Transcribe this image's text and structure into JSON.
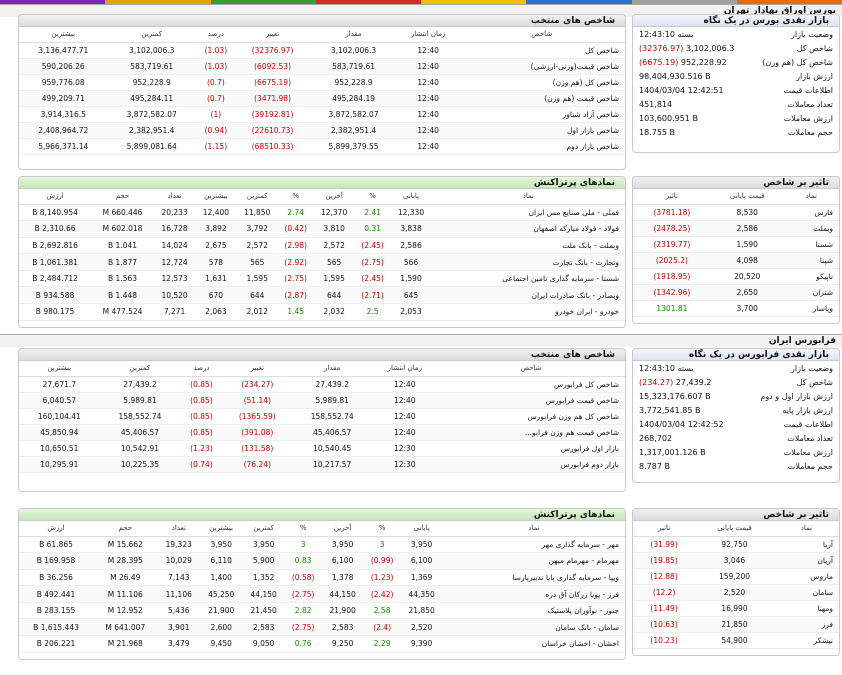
{
  "colors": {
    "negative": "#c00000",
    "positive": "#118a00",
    "topbar": [
      "#7b2ab8",
      "#e8a000",
      "#3a9c2f",
      "#d42a2a",
      "#f0c000",
      "#2a6fd4",
      "#a0a0a0",
      "#e86a00"
    ]
  },
  "tehran": {
    "title": "بورس اوراق بهادار تهران",
    "summary_title": "بازار نقدی بورس در یک نگاه",
    "summary": [
      {
        "k": "وضعیت بازار",
        "v": "بسته 12:43:10",
        "c": ""
      },
      {
        "k": "شاخص کل",
        "v": "3,102,006.3",
        "ch": "(32376.97)",
        "c": "neg"
      },
      {
        "k": "شاخص کل (هم وزن)",
        "v": "952,228.92",
        "ch": "(6675.19)",
        "c": "neg"
      },
      {
        "k": "ارزش بازار",
        "v": "98,404,930.516 B",
        "c": ""
      },
      {
        "k": "اطلاعات قیمت",
        "v": "1404/03/04 12:42:51",
        "c": ""
      },
      {
        "k": "تعداد معاملات",
        "v": "451,814",
        "c": ""
      },
      {
        "k": "ارزش معاملات",
        "v": "103,600.951 B",
        "c": ""
      },
      {
        "k": "حجم معاملات",
        "v": "18.755 B",
        "c": ""
      }
    ],
    "indices_title": "شاخص های منتخب",
    "indices_headers": [
      "شاخص",
      "زمان انتشار",
      "مقدار",
      "تغییر",
      "درصد",
      "کمترین",
      "بیشترین"
    ],
    "indices": [
      [
        "شاخص کل",
        "12:40",
        "3,102,006.3",
        "(32376.97)",
        "(1.03)",
        "3,102,006.3",
        "3,136,477.71"
      ],
      [
        "شاخص قیمت(وزنی-ارزشی)",
        "12:40",
        "583,719.61",
        "(6092.53)",
        "(1.03)",
        "583,719.61",
        "590,206.26"
      ],
      [
        "شاخص کل (هم وزن)",
        "12:40",
        "952,228.9",
        "(6675.19)",
        "(0.7)",
        "952,228.9",
        "959,776.08"
      ],
      [
        "شاخص قیمت (هم وزن)",
        "12:40",
        "495,284.19",
        "(3471.98)",
        "(0.7)",
        "495,284.11",
        "499,209.71"
      ],
      [
        "شاخص آزاد شناور",
        "12:40",
        "3,872,582.07",
        "(39192.81)",
        "(1)",
        "3,872,582.07",
        "3,914,316.5"
      ],
      [
        "شاخص بازار اول",
        "12:40",
        "2,382,951.4",
        "(22610.73)",
        "(0.94)",
        "2,382,951.4",
        "2,408,964.72"
      ],
      [
        "شاخص بازار دوم",
        "12:40",
        "5,899,379.55",
        "(68510.33)",
        "(1.15)",
        "5,899,081.64",
        "5,966,371.14"
      ]
    ],
    "impact_title": "تاثیر بر شاخص",
    "impact_headers": [
      "نماد",
      "قیمت پایانی",
      "تاثیر"
    ],
    "impact": [
      [
        "فارس",
        "8,530",
        "(3781.18)",
        "neg"
      ],
      [
        "وبملت",
        "2,586",
        "(2478.25)",
        "neg"
      ],
      [
        "شستا",
        "1,590",
        "(2319.77)",
        "neg"
      ],
      [
        "شپنا",
        "4,098",
        "(2025.2)",
        "neg"
      ],
      [
        "تاپیکو",
        "20,520",
        "(1918.95)",
        "neg"
      ],
      [
        "شتران",
        "2,650",
        "(1342.96)",
        "neg"
      ],
      [
        "وپاسار",
        "3,700",
        "1301.81",
        "pos"
      ]
    ],
    "top_title": "نمادهای پرتراکنش",
    "top_headers": [
      "نماد",
      "پایانی",
      "%",
      "آخرین",
      "%",
      "کمترین",
      "بیشترین",
      "تعداد",
      "حجم",
      "ارزش"
    ],
    "top": [
      [
        "فملی - ملی صنایع مس ایران",
        "12,330",
        "2.41",
        "12,370",
        "2.74",
        "11,850",
        "12,400",
        "20,233",
        "660.446 M",
        "8,140.954 B",
        "pos",
        "pos"
      ],
      [
        "فولاد - فولاد مبارکه اصفهان",
        "3,838",
        "0.31",
        "3,810",
        "(0.42)",
        "3,792",
        "3,892",
        "16,728",
        "602.018 M",
        "2,310.66 B",
        "pos",
        "neg"
      ],
      [
        "وبملت - بانک ملت",
        "2,586",
        "(2.45)",
        "2,572",
        "(2.98)",
        "2,572",
        "2,675",
        "14,024",
        "1.041 B",
        "2,692.816 B",
        "neg",
        "neg"
      ],
      [
        "وتجارت - بانک تجارت",
        "566",
        "(2.75)",
        "565",
        "(2.92)",
        "565",
        "578",
        "12,724",
        "1.877 B",
        "1,061.381 B",
        "neg",
        "neg"
      ],
      [
        "شستا - سرمایه گذاری تامین اجتماعی",
        "1,590",
        "(2.45)",
        "1,595",
        "(2.75)",
        "1,595",
        "1,631",
        "12,573",
        "1.563 B",
        "2,484.712 B",
        "neg",
        "neg"
      ],
      [
        "وبصادر - بانک صادرات ایران",
        "645",
        "(2.71)",
        "644",
        "(2.87)",
        "644",
        "670",
        "10,520",
        "1.448 B",
        "934.588 B",
        "neg",
        "neg"
      ],
      [
        "خودرو - ایران خودرو",
        "2,053",
        "2.5",
        "2,032",
        "1.45",
        "2,012",
        "2,063",
        "7,271",
        "477.524 M",
        "980.175 B",
        "pos",
        "pos"
      ]
    ]
  },
  "farabourse": {
    "title": "فرابورس ایران",
    "summary_title": "بازار نقدی فرابورس در یک نگاه",
    "summary": [
      {
        "k": "وضعیت بازار",
        "v": "بسته 12:43:10",
        "c": ""
      },
      {
        "k": "شاخص کل",
        "v": "27,439.2",
        "ch": "(234.27)",
        "c": "neg"
      },
      {
        "k": "ارزش بازار اول و دوم",
        "v": "15,323,176.607 B",
        "c": ""
      },
      {
        "k": "ارزش بازار پایه",
        "v": "3,772,541.85 B",
        "c": ""
      },
      {
        "k": "اطلاعات قیمت",
        "v": "1404/03/04 12:42:52",
        "c": ""
      },
      {
        "k": "تعداد معاملات",
        "v": "268,702",
        "c": ""
      },
      {
        "k": "ارزش معاملات",
        "v": "1,317,001.126 B",
        "c": ""
      },
      {
        "k": "حجم معاملات",
        "v": "8.787 B",
        "c": ""
      }
    ],
    "indices_title": "شاخص های منتخب",
    "indices_headers": [
      "شاخص",
      "زمان انتشار",
      "مقدار",
      "تغییر",
      "درصد",
      "کمترین",
      "بیشترین"
    ],
    "indices": [
      [
        "شاخص کل فرابورس",
        "12:40",
        "27,439.2",
        "(234.27)",
        "(0.85)",
        "27,439.2",
        "27,671.7"
      ],
      [
        "شاخص قیمت فرابورس",
        "12:40",
        "5,989.81",
        "(51.14)",
        "(0.85)",
        "5,989.81",
        "6,040.57"
      ],
      [
        "شاخص کل هم وزن فرابورس",
        "12:40",
        "158,552.74",
        "(1365.59)",
        "(0.85)",
        "158,552.74",
        "160,104.41"
      ],
      [
        "شاخص قیمت هم وزن فرابو...",
        "12:40",
        "45,406.57",
        "(391.08)",
        "(0.85)",
        "45,406.57",
        "45,850.94"
      ],
      [
        "بازار اول فرابورس",
        "12:30",
        "10,540.45",
        "(131.58)",
        "(1.23)",
        "10,542.91",
        "10,650.51"
      ],
      [
        "بازار دوم فرابورس",
        "12:30",
        "10,217.57",
        "(76.24)",
        "(0.74)",
        "10,225.35",
        "10,295.91"
      ]
    ],
    "impact_title": "تاثیر بر شاخص",
    "impact_headers": [
      "نماد",
      "قیمت پایانی",
      "تاثیر"
    ],
    "impact": [
      [
        "آریا",
        "92,750",
        "(31.99)",
        "neg"
      ],
      [
        "آریان",
        "3,046",
        "(19.85)",
        "neg"
      ],
      [
        "ماروس",
        "159,200",
        "(12.88)",
        "neg"
      ],
      [
        "سامان",
        "2,520",
        "(12.2)",
        "neg"
      ],
      [
        "ومهنا",
        "16,990",
        "(11.49)",
        "neg"
      ],
      [
        "فرز",
        "21,850",
        "(10.63)",
        "neg"
      ],
      [
        "نیشکر",
        "54,900",
        "(10.23)",
        "neg"
      ]
    ],
    "top_title": "نمادهای پرتراکنش",
    "top_headers": [
      "نماد",
      "پایانی",
      "%",
      "آخرین",
      "%",
      "کمترین",
      "بیشترین",
      "تعداد",
      "حجم",
      "ارزش"
    ],
    "top": [
      [
        "مهر - سرمایه گذاری مهر",
        "3,950",
        "3",
        "3,950",
        "3",
        "3,950",
        "3,950",
        "19,323",
        "15.662 M",
        "61.865 B",
        "pos",
        "pos"
      ],
      [
        "مهرمام - مهرمام میهن",
        "6,100",
        "(0.99)",
        "6,100",
        "0.83",
        "5,900",
        "6,110",
        "10,029",
        "28.395 M",
        "169.958 B",
        "neg",
        "pos"
      ],
      [
        "ویپا - سرمایه گذاری پایا تدبیرپارسا",
        "1,369",
        "(1.23)",
        "1,378",
        "(0.58)",
        "1,352",
        "1,400",
        "7,143",
        "26.49 M",
        "36.256 B",
        "neg",
        "neg"
      ],
      [
        "فرز - پویا زرکان آق دره",
        "44,350",
        "(2.42)",
        "44,150",
        "(2.75)",
        "44,150",
        "45,250",
        "11,106",
        "11.106 M",
        "492.441 B",
        "neg",
        "neg"
      ],
      [
        "جنور - نوآوران پلاستیک",
        "21,850",
        "2.58",
        "21,900",
        "2.82",
        "21,450",
        "21,900",
        "5,436",
        "12.952 M",
        "283.155 B",
        "pos",
        "pos"
      ],
      [
        "سامان - بانک سامان",
        "2,520",
        "(2.4)",
        "2,583",
        "(2.75)",
        "2,583",
        "2,600",
        "3,901",
        "641.007 M",
        "1,615.443 B",
        "neg",
        "neg"
      ],
      [
        "اخشان - اخشان خراسان",
        "9,390",
        "2.29",
        "9,250",
        "0.76",
        "9,050",
        "9,450",
        "3,479",
        "21.968 M",
        "206.221 B",
        "pos",
        "pos"
      ]
    ]
  }
}
